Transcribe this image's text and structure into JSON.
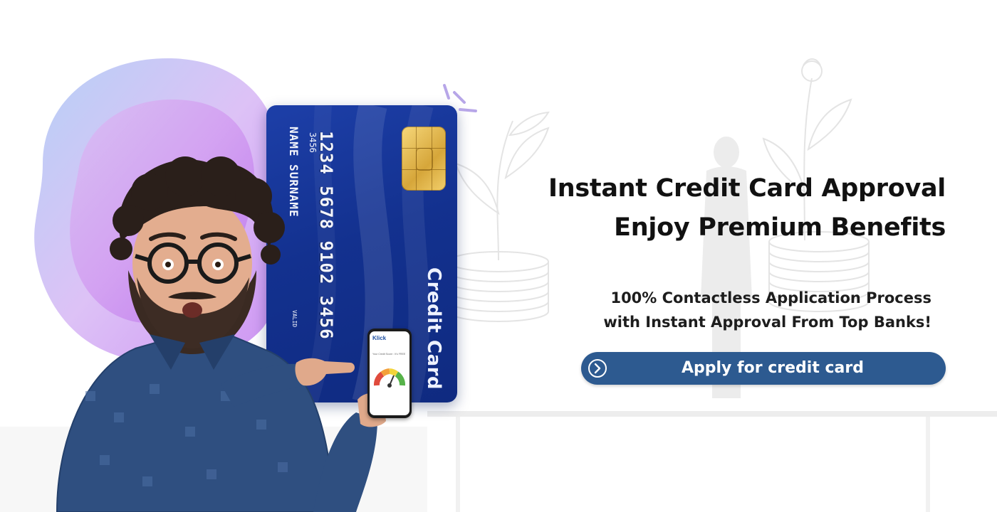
{
  "banner": {
    "headline_line1": "Instant Credit Card Approval",
    "headline_line2": "Enjoy Premium Benefits",
    "subline_line1": "100% Contactless Application Process",
    "subline_line2": "with Instant Approval From Top Banks!",
    "cta_label": "Apply for credit card",
    "cta_icon": "chevron-right-circle-icon"
  },
  "card": {
    "number": "1234  5678  9102  3456",
    "sub_number": "3456",
    "holder_name": "NAME  SURNAME",
    "valid_label": "VALID",
    "label": "Credit Card"
  },
  "phone": {
    "brand": "Klick",
    "screen_text": "Your Credit Score : It's FREE"
  },
  "colors": {
    "cta_background": "#2d5a90",
    "card_blue": "#13318f",
    "headline_text": "#111111",
    "blob_purple": "#c47ff0",
    "blob_blue": "#a9c8f5"
  }
}
